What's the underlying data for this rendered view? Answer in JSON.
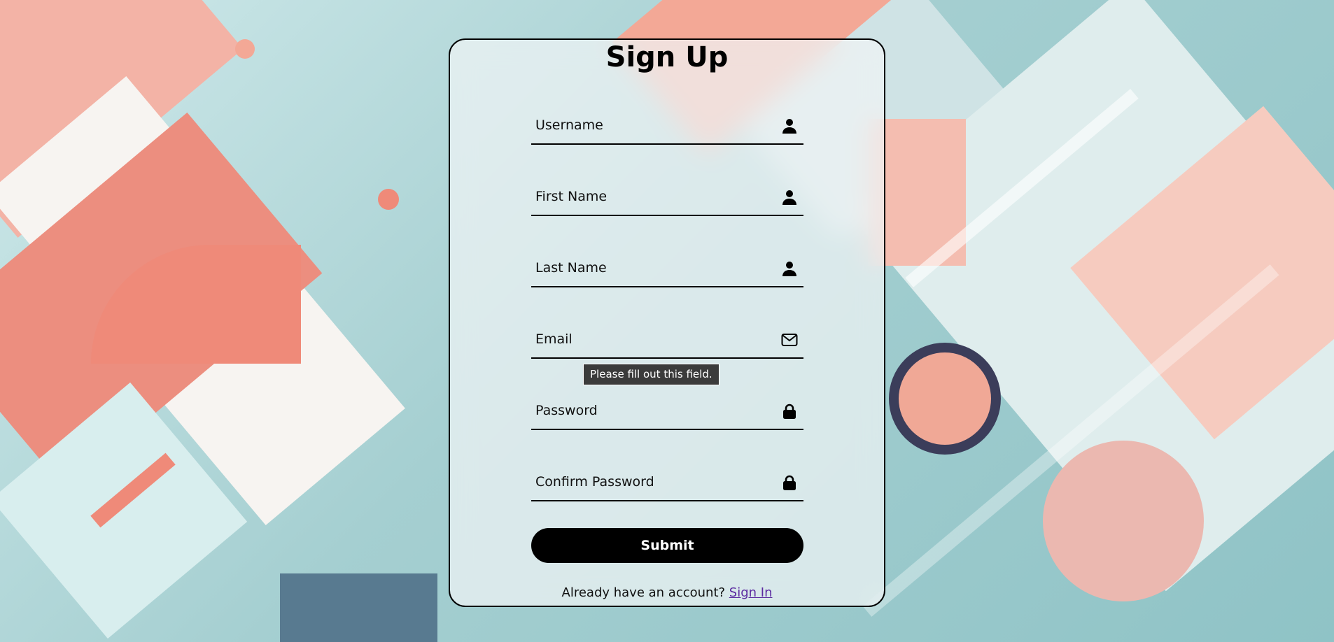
{
  "form": {
    "title": "Sign Up",
    "fields": [
      {
        "placeholder": "Username",
        "value": "",
        "icon": "user-icon"
      },
      {
        "placeholder": "First Name",
        "value": "",
        "icon": "user-icon"
      },
      {
        "placeholder": "Last Name",
        "value": "",
        "icon": "user-icon"
      },
      {
        "placeholder": "Email",
        "value": "",
        "icon": "envelope-icon"
      },
      {
        "placeholder": "Password",
        "value": "",
        "icon": "lock-icon"
      },
      {
        "placeholder": "Confirm Password",
        "value": "",
        "icon": "lock-icon"
      }
    ],
    "validation_tooltip": "Please fill out this field.",
    "submit_label": "Submit",
    "footer_text": "Already have an account? ",
    "signin_link": "Sign In"
  },
  "colors": {
    "card_border": "#000000",
    "button_bg": "#000000",
    "button_text": "#ffffff",
    "link": "#5b2aa0",
    "tooltip_bg": "#3b3b3b"
  }
}
